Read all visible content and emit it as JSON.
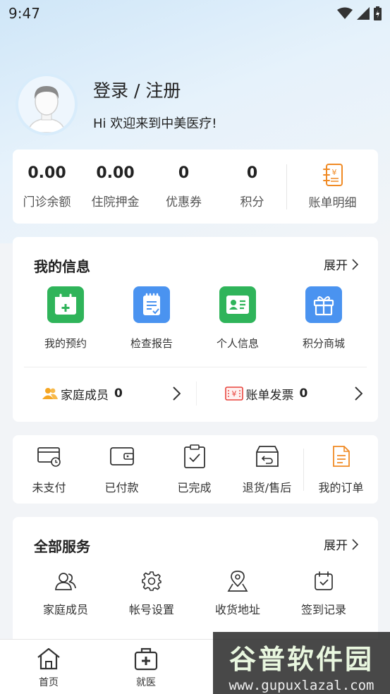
{
  "status_bar": {
    "time": "9:47"
  },
  "profile": {
    "title": "登录 / 注册",
    "welcome": "Hi 欢迎来到中美医疗!"
  },
  "balances": [
    {
      "value": "0.00",
      "label": "门诊余额"
    },
    {
      "value": "0.00",
      "label": "住院押金"
    },
    {
      "value": "0",
      "label": "优惠券"
    },
    {
      "value": "0",
      "label": "积分"
    }
  ],
  "bill_detail": {
    "label": "账单明细"
  },
  "my_info": {
    "title": "我的信息",
    "expand": "展开",
    "items": [
      {
        "label": "我的预约",
        "icon": "calendar-plus-icon",
        "color": "#2fb45a"
      },
      {
        "label": "检查报告",
        "icon": "report-clipboard-icon",
        "color": "#4a93f0"
      },
      {
        "label": "个人信息",
        "icon": "id-card-icon",
        "color": "#2fb45a"
      },
      {
        "label": "积分商城",
        "icon": "gift-icon",
        "color": "#4a93f0"
      }
    ],
    "family": {
      "label": "家庭成员",
      "count": "0"
    },
    "invoice": {
      "label": "账单发票",
      "count": "0"
    }
  },
  "orders": [
    {
      "label": "未支付",
      "icon": "unpaid-card-icon"
    },
    {
      "label": "已付款",
      "icon": "wallet-icon"
    },
    {
      "label": "已完成",
      "icon": "clipboard-check-icon"
    },
    {
      "label": "退货/售后",
      "icon": "return-box-icon"
    },
    {
      "label": "我的订单",
      "icon": "order-document-icon"
    }
  ],
  "services": {
    "title": "全部服务",
    "expand": "展开",
    "items": [
      {
        "label": "家庭成员",
        "icon": "users-icon"
      },
      {
        "label": "帐号设置",
        "icon": "gear-icon"
      },
      {
        "label": "收货地址",
        "icon": "location-pin-icon"
      },
      {
        "label": "签到记录",
        "icon": "calendar-check-icon"
      }
    ]
  },
  "tabbar": [
    {
      "label": "首页",
      "icon": "home-icon"
    },
    {
      "label": "就医",
      "icon": "medical-kit-icon"
    }
  ],
  "watermark": {
    "brand": "谷普软件园",
    "url": "www.gupuxlazal.com"
  },
  "colors": {
    "accent_orange": "#f08a24",
    "green": "#2fb45a",
    "blue": "#4a93f0",
    "invoice_red": "#e8433c"
  }
}
